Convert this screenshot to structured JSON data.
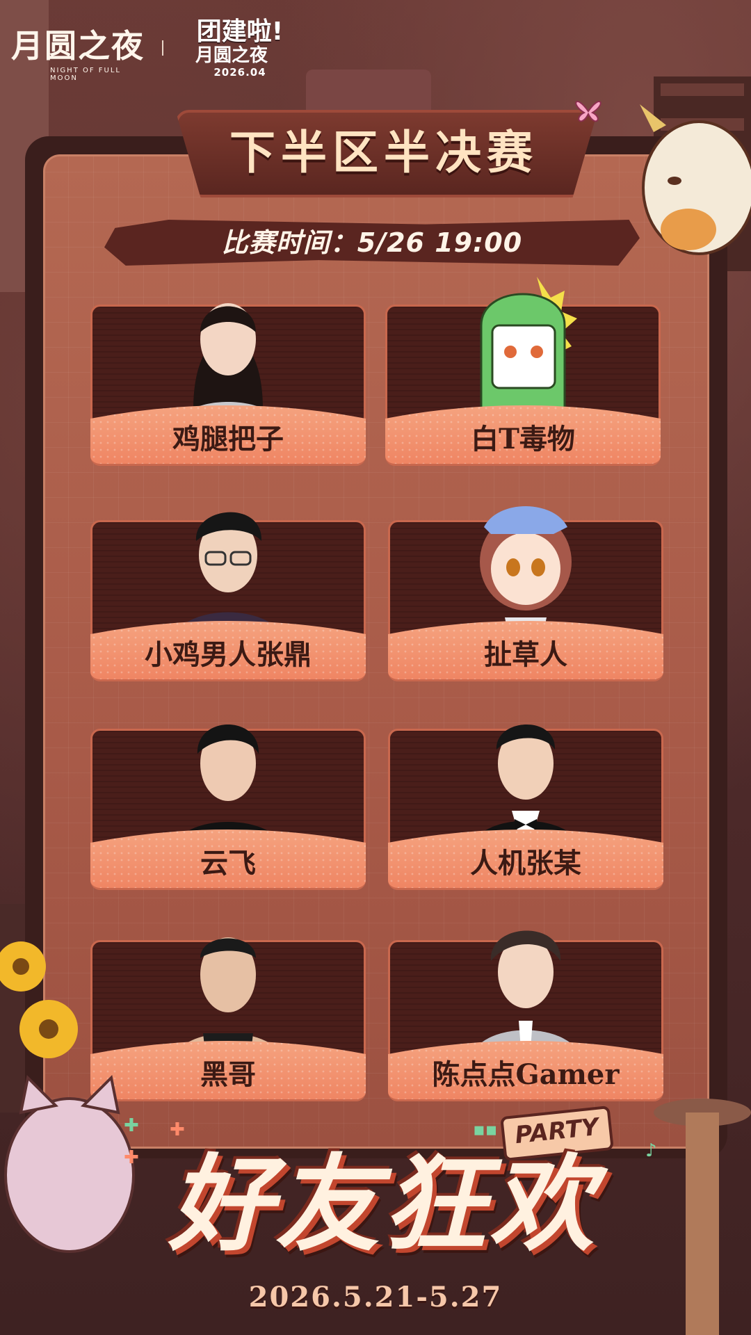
{
  "header": {
    "game_logo": "月圆之夜",
    "game_logo_sub": "NIGHT OF FULL MOON",
    "event_line1": "团建啦!",
    "event_line2": "月圆之夜",
    "event_date": "2026.04"
  },
  "title": "下半区半决赛",
  "match_time": "比赛时间：5/26 19:00",
  "players": [
    {
      "name": "鸡腿把子",
      "avatar": "woman-long-hair-avatar"
    },
    {
      "name": "白T毒物",
      "avatar": "green-dinosaur-mascot-avatar"
    },
    {
      "name": "小鸡男人张鼎",
      "avatar": "man-glasses-avatar"
    },
    {
      "name": "扯草人",
      "avatar": "anime-girl-avatar"
    },
    {
      "name": "云飞",
      "avatar": "man-black-tshirt-avatar"
    },
    {
      "name": "人机张某",
      "avatar": "man-bowtie-avatar"
    },
    {
      "name": "黑哥",
      "avatar": "man-tank-top-avatar"
    },
    {
      "name": "陈点点Gamer",
      "avatar": "man-grey-suit-avatar"
    }
  ],
  "footer": {
    "party_tag": "PARTY",
    "banner": "好友狂欢",
    "date_range": "2026.5.21-5.27"
  },
  "colors": {
    "board": "#a85a48",
    "frame": "#3a1e1c",
    "title_text": "#ffe4c2",
    "name_plate": "#f29270",
    "accent_green": "#7ad3a0"
  }
}
